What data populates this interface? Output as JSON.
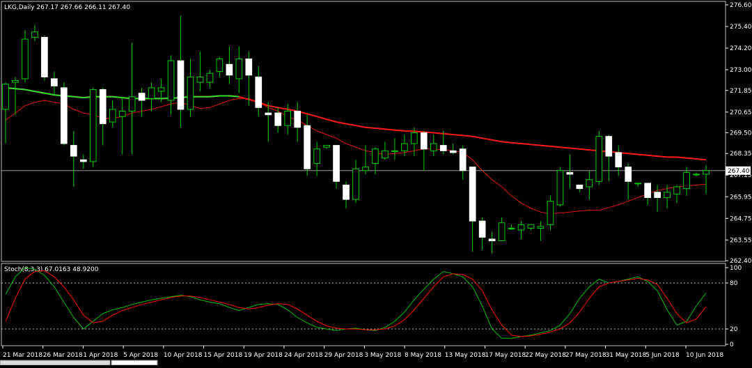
{
  "chart_data": [
    {
      "type": "candlestick",
      "header": "LKG,Daily  267.17 267.66 266.11 267.40",
      "ylim": [
        262.4,
        276.6
      ],
      "y_ticks": [
        "276.60",
        "275.40",
        "274.20",
        "273.00",
        "271.85",
        "270.65",
        "269.50",
        "268.35",
        "267.15",
        "265.95",
        "264.75",
        "263.55",
        "262.40"
      ],
      "current_price": 267.4,
      "current_price_label": "267.40",
      "x_labels": [
        "21 Mar 2018",
        "26 Mar 2018",
        "1 Apr 2018",
        "5 Apr 2018",
        "10 Apr 2018",
        "15 Apr 2018",
        "19 Apr 2018",
        "24 Apr 2018",
        "29 Apr 2018",
        "3 May 2018",
        "8 May 2018",
        "13 May 2018",
        "17 May 2018",
        "22 May 2018",
        "27 May 2018",
        "31 May 2018",
        "5 Jun 2018",
        "10 Jun 2018"
      ],
      "candles": [
        [
          270.8,
          272.2,
          268.9,
          272.3
        ],
        [
          272.3,
          272.4,
          270.5,
          272.6
        ],
        [
          272.5,
          274.7,
          272.3,
          275.2
        ],
        [
          274.8,
          275.1,
          274.6,
          275.5
        ],
        [
          274.8,
          272.6,
          272.4,
          274.9
        ],
        [
          272.5,
          272.1,
          271.6,
          272.9
        ],
        [
          272.0,
          268.9,
          268.8,
          272.3
        ],
        [
          268.8,
          268.2,
          266.5,
          269.6
        ],
        [
          268.0,
          267.9,
          267.5,
          268.3
        ],
        [
          267.9,
          271.9,
          267.6,
          272.0
        ],
        [
          271.9,
          270.0,
          268.8,
          272.0
        ],
        [
          270.1,
          270.8,
          269.8,
          271.3
        ],
        [
          270.4,
          270.7,
          268.3,
          271.5
        ],
        [
          270.7,
          271.5,
          268.3,
          274.5
        ],
        [
          271.7,
          271.3,
          270.4,
          272.0
        ],
        [
          271.4,
          272.0,
          270.7,
          272.3
        ],
        [
          271.8,
          272.0,
          271.2,
          272.5
        ],
        [
          271.3,
          273.5,
          270.5,
          273.8
        ],
        [
          273.5,
          270.8,
          269.8,
          276.0
        ],
        [
          270.8,
          272.6,
          270.4,
          273.6
        ],
        [
          272.3,
          272.6,
          271.8,
          274.0
        ],
        [
          272.3,
          272.8,
          272.0,
          273.0
        ],
        [
          272.9,
          273.6,
          272.6,
          273.7
        ],
        [
          273.3,
          272.7,
          272.2,
          274.3
        ],
        [
          272.5,
          273.6,
          271.7,
          274.3
        ],
        [
          273.6,
          272.7,
          271.0,
          274.0
        ],
        [
          272.6,
          270.9,
          270.4,
          273.2
        ],
        [
          270.6,
          270.5,
          269.0,
          271.2
        ],
        [
          270.6,
          269.9,
          269.5,
          270.9
        ],
        [
          269.9,
          270.7,
          269.4,
          271.1
        ],
        [
          270.7,
          269.8,
          269.0,
          271.2
        ],
        [
          269.9,
          267.5,
          267.1,
          270.5
        ],
        [
          267.8,
          268.6,
          267.1,
          269.0
        ],
        [
          268.7,
          268.8,
          268.6,
          268.8
        ],
        [
          268.8,
          266.8,
          266.4,
          268.8
        ],
        [
          266.6,
          265.8,
          265.3,
          266.8
        ],
        [
          265.8,
          267.5,
          265.6,
          268.0
        ],
        [
          267.4,
          267.6,
          267.2,
          268.8
        ],
        [
          267.8,
          268.6,
          267.2,
          268.7
        ],
        [
          268.1,
          268.5,
          268.0,
          269.0
        ],
        [
          268.5,
          268.5,
          268.0,
          269.2
        ],
        [
          268.5,
          268.9,
          268.2,
          269.4
        ],
        [
          268.9,
          269.5,
          268.2,
          269.8
        ],
        [
          269.5,
          268.6,
          267.4,
          269.6
        ],
        [
          268.5,
          268.9,
          268.2,
          269.4
        ],
        [
          268.8,
          268.5,
          268.3,
          269.6
        ],
        [
          268.5,
          268.4,
          268.3,
          268.9
        ],
        [
          268.6,
          267.4,
          266.9,
          268.8
        ],
        [
          267.6,
          264.6,
          262.9,
          267.6
        ],
        [
          264.6,
          263.7,
          263.0,
          264.8
        ],
        [
          263.6,
          263.5,
          262.8,
          264.0
        ],
        [
          263.5,
          264.5,
          263.5,
          264.8
        ],
        [
          264.2,
          264.2,
          264.1,
          264.4
        ],
        [
          264.1,
          264.4,
          263.6,
          264.6
        ],
        [
          264.2,
          264.4,
          264.1,
          264.4
        ],
        [
          264.2,
          264.3,
          263.5,
          264.6
        ],
        [
          264.4,
          265.7,
          264.1,
          266.0
        ],
        [
          265.5,
          267.4,
          265.4,
          267.6
        ],
        [
          267.3,
          267.2,
          266.4,
          268.3
        ],
        [
          266.6,
          266.4,
          266.2,
          266.6
        ],
        [
          266.5,
          266.9,
          265.8,
          267.4
        ],
        [
          266.8,
          269.3,
          266.6,
          269.6
        ],
        [
          269.3,
          268.2,
          266.8,
          269.4
        ],
        [
          268.4,
          267.6,
          267.1,
          268.8
        ],
        [
          267.6,
          266.8,
          265.8,
          267.8
        ],
        [
          266.7,
          266.7,
          266.5,
          266.7
        ],
        [
          266.7,
          265.9,
          265.5,
          266.7
        ],
        [
          266.2,
          265.9,
          265.1,
          266.6
        ],
        [
          265.9,
          266.2,
          265.3,
          266.6
        ],
        [
          266.1,
          266.5,
          265.6,
          266.6
        ],
        [
          266.4,
          267.3,
          266.0,
          267.6
        ],
        [
          267.2,
          267.2,
          267.1,
          267.3
        ],
        [
          267.2,
          267.4,
          266.1,
          267.7
        ]
      ],
      "ma_long": [
        272.0,
        271.95,
        271.9,
        271.8,
        271.7,
        271.6,
        271.55,
        271.5,
        271.45,
        271.5,
        271.5,
        271.5,
        271.45,
        271.4,
        271.4,
        271.4,
        271.4,
        271.42,
        271.45,
        271.5,
        271.5,
        271.5,
        271.55,
        271.55,
        271.5,
        271.35,
        271.2,
        271.0,
        270.9,
        270.8,
        270.7,
        270.55,
        270.4,
        270.25,
        270.1,
        270.0,
        269.9,
        269.8,
        269.75,
        269.7,
        269.65,
        269.6,
        269.58,
        269.55,
        269.5,
        269.45,
        269.4,
        269.35,
        269.3,
        269.2,
        269.1,
        269.0,
        268.95,
        268.9,
        268.85,
        268.8,
        268.75,
        268.7,
        268.65,
        268.6,
        268.55,
        268.5,
        268.45,
        268.4,
        268.35,
        268.3,
        268.25,
        268.2,
        268.15,
        268.15,
        268.1,
        268.05,
        268.0
      ],
      "ma_short": [
        270.2,
        270.6,
        271.0,
        271.2,
        271.3,
        271.2,
        271.1,
        270.8,
        270.6,
        270.5,
        270.3,
        270.3,
        270.4,
        270.6,
        270.7,
        270.8,
        270.95,
        271.1,
        271.2,
        271.0,
        270.85,
        270.9,
        271.1,
        271.3,
        271.4,
        271.4,
        271.2,
        270.9,
        270.7,
        270.4,
        270.2,
        269.9,
        269.6,
        269.4,
        269.2,
        268.9,
        268.7,
        268.5,
        268.4,
        268.3,
        268.35,
        268.4,
        268.5,
        268.6,
        268.6,
        268.55,
        268.5,
        268.4,
        268.0,
        267.4,
        266.9,
        266.5,
        266.0,
        265.6,
        265.3,
        265.1,
        265.0,
        265.05,
        265.1,
        265.15,
        265.2,
        265.2,
        265.35,
        265.5,
        265.7,
        265.9,
        266.1,
        266.3,
        266.4,
        266.5,
        266.55,
        266.6,
        266.65
      ]
    },
    {
      "type": "line",
      "header": "Stoch(8,3,3) 67.0163 48.9200",
      "ylim": [
        0,
        100
      ],
      "y_ticks": [
        "100",
        "80",
        "20",
        "0"
      ],
      "levels": [
        80,
        20
      ],
      "series": [
        {
          "name": "%K",
          "color": "#00c000",
          "values": [
            65,
            88,
            100,
            98,
            90,
            75,
            55,
            35,
            20,
            30,
            40,
            45,
            48,
            52,
            55,
            58,
            60,
            62,
            64,
            62,
            58,
            55,
            53,
            48,
            44,
            48,
            52,
            53,
            52,
            45,
            35,
            28,
            22,
            20,
            18,
            20,
            21,
            19,
            18,
            22,
            30,
            42,
            58,
            72,
            85,
            95,
            92,
            88,
            75,
            50,
            20,
            8,
            8,
            10,
            12,
            15,
            18,
            25,
            40,
            60,
            75,
            85,
            80,
            82,
            85,
            88,
            82,
            70,
            45,
            25,
            30,
            50,
            67
          ]
        },
        {
          "name": "%D",
          "color": "#ff0000",
          "values": [
            30,
            60,
            85,
            95,
            96,
            88,
            75,
            58,
            38,
            28,
            30,
            38,
            44,
            48,
            52,
            55,
            58,
            61,
            63,
            63,
            61,
            58,
            55,
            52,
            48,
            46,
            48,
            51,
            53,
            52,
            46,
            38,
            30,
            24,
            21,
            20,
            20,
            19,
            19,
            20,
            24,
            32,
            45,
            60,
            75,
            88,
            92,
            91,
            85,
            70,
            45,
            25,
            12,
            10,
            11,
            13,
            16,
            20,
            28,
            42,
            60,
            75,
            80,
            82,
            84,
            86,
            84,
            78,
            60,
            40,
            28,
            33,
            49
          ]
        }
      ]
    }
  ]
}
